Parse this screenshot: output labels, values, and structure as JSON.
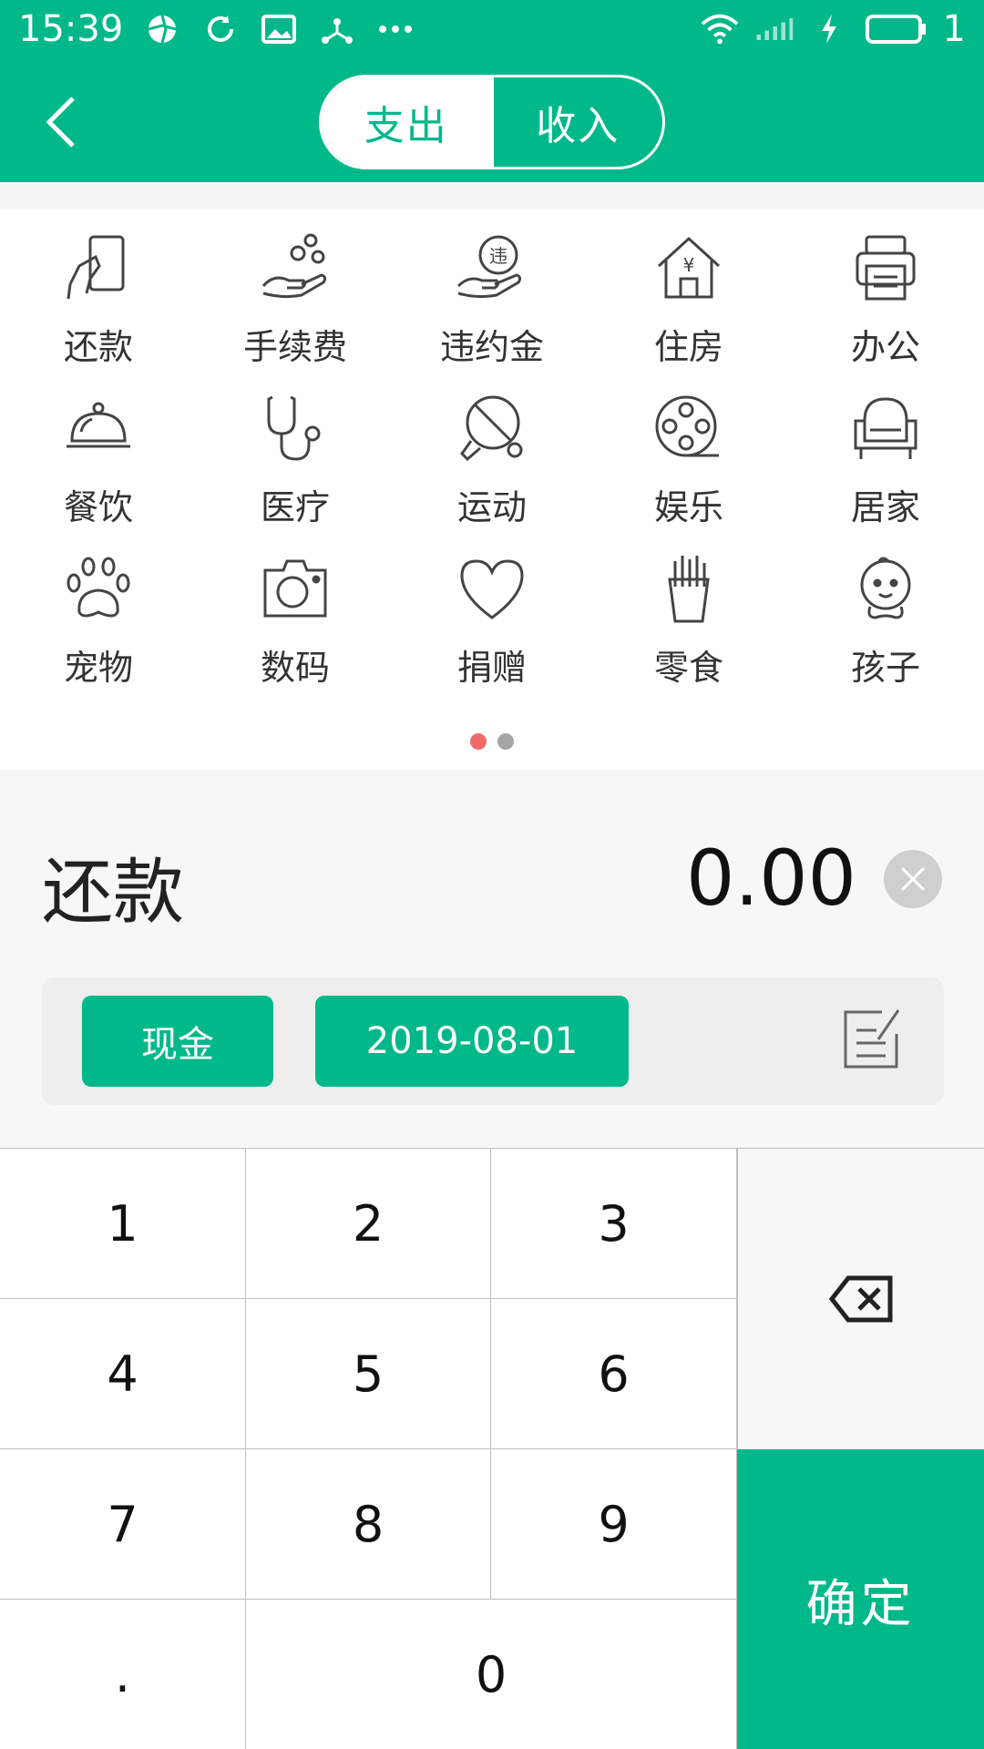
{
  "status_bar": {
    "time": "15:39",
    "battery_level": "1"
  },
  "header": {
    "tabs": [
      {
        "label": "支出",
        "active": true
      },
      {
        "label": "收入",
        "active": false
      }
    ]
  },
  "categories": [
    {
      "label": "还款",
      "icon": "card-hand-icon"
    },
    {
      "label": "手续费",
      "icon": "coins-hand-icon"
    },
    {
      "label": "违约金",
      "icon": "penalty-hand-icon"
    },
    {
      "label": "住房",
      "icon": "house-yen-icon"
    },
    {
      "label": "办公",
      "icon": "printer-icon"
    },
    {
      "label": "餐饮",
      "icon": "food-cloche-icon"
    },
    {
      "label": "医疗",
      "icon": "stethoscope-icon"
    },
    {
      "label": "运动",
      "icon": "ping-pong-icon"
    },
    {
      "label": "娱乐",
      "icon": "film-reel-icon"
    },
    {
      "label": "居家",
      "icon": "armchair-icon"
    },
    {
      "label": "宠物",
      "icon": "paw-icon"
    },
    {
      "label": "数码",
      "icon": "camera-icon"
    },
    {
      "label": "捐赠",
      "icon": "heart-icon"
    },
    {
      "label": "零食",
      "icon": "fries-icon"
    },
    {
      "label": "孩子",
      "icon": "baby-icon"
    }
  ],
  "pager": {
    "pages": 2,
    "current": 1
  },
  "entry": {
    "selected_category": "还款",
    "amount": "0.00",
    "account": "现金",
    "date": "2019-08-01"
  },
  "keypad": {
    "keys": [
      "1",
      "2",
      "3",
      "4",
      "5",
      "6",
      "7",
      "8",
      "9",
      ".",
      "0"
    ],
    "confirm_label": "确定"
  },
  "colors": {
    "accent": "#00b88a",
    "pager_active": "#f06a6a",
    "pager_inactive": "#a5a5a5"
  }
}
